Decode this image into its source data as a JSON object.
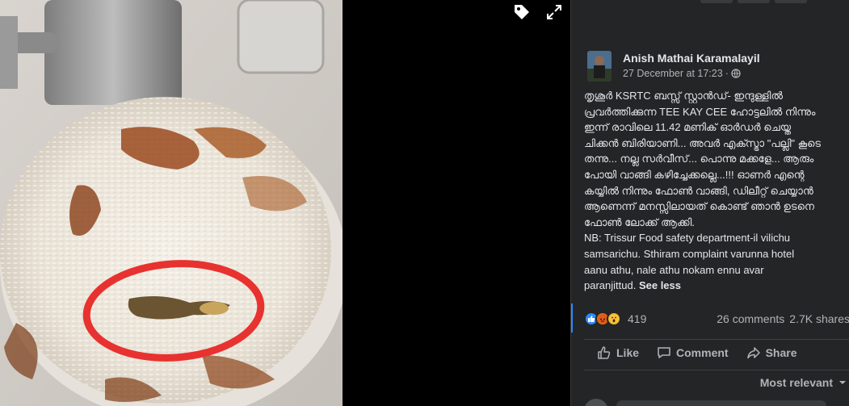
{
  "post": {
    "author": "Anish Mathai Karamalayil",
    "timestamp": "27 December at 17:23",
    "separator": "·",
    "text_lines": [
      "തൃശൂർ KSRTC ബസ്സ് സ്റ്റാൻഡ്- ഇന്ദുള്ളിൽ",
      "പ്രവർത്തിക്കുന്ന TEE KAY CEE ഹോട്ടലിൽ നിന്നും",
      "ഇന്ന് രാവിലെ 11.42 മണിക് ഓർഡർ ചെയ്ത",
      "ചിക്കൻ ബിരിയാണി... അവർ എക്സ്ട്രാ \"പല്ലി\" കൂടെ",
      "തന്നു... നല്ല സർവീസ്... പൊന്നു മക്കളേ... ആരും",
      "പോയി വാങ്ങി കഴിച്ചേക്കല്ലെ...!!! ഓണർ എന്റെ",
      "കയ്യിൽ നിന്നും ഫോൺ വാങ്ങി, ഡിലീറ്റ് ചെയ്യാൻ",
      "ആണെന്ന് മനസ്സിലായത് കൊണ്ട് ഞാൻ ഉടനെ",
      "ഫോൺ ലോക്ക് ആക്കി.",
      "NB: Trissur Food safety department-il vilichu",
      "samsarichu. Sthiram complaint varunna hotel",
      "aanu athu, nale athu nokam ennu avar",
      "paranjittud."
    ],
    "see_less": "See less"
  },
  "stats": {
    "reaction_count": "419",
    "comments": "26 comments",
    "shares": "2.7K shares"
  },
  "actions": {
    "like": "Like",
    "comment": "Comment",
    "share": "Share"
  },
  "sort": {
    "label": "Most relevant"
  },
  "icons": {
    "tag": "tag-icon",
    "expand": "expand-icon",
    "privacy": "globe-icon"
  },
  "colors": {
    "panel_bg": "#242526",
    "text": "#e4e6eb",
    "muted": "#b0b3b8",
    "like_blue": "#2d88ff"
  }
}
